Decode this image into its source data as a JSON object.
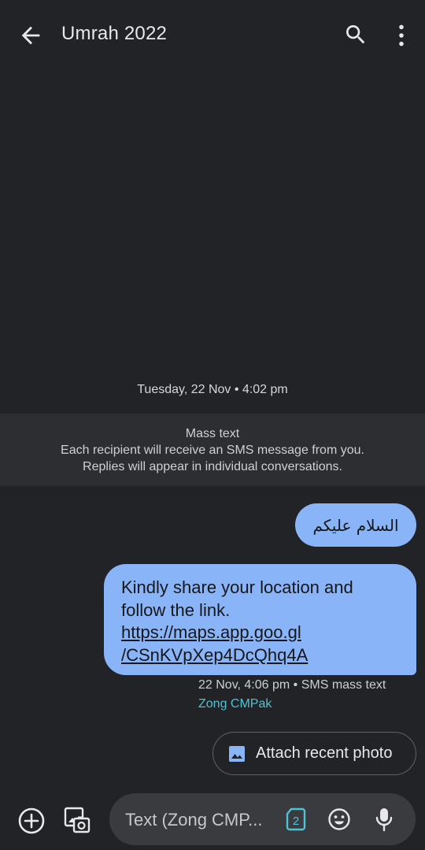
{
  "header": {
    "title": "Umrah 2022"
  },
  "conversation": {
    "date_separator": "Tuesday, 22 Nov • 4:02 pm",
    "mass_text_banner": {
      "heading": "Mass text",
      "line1": "Each recipient will receive an SMS message from you.",
      "line2": "Replies will appear in individual conversations."
    },
    "messages": [
      {
        "text": "السلام علیکم"
      },
      {
        "line1": "Kindly share your location and",
        "line2": "follow the link.",
        "link_line1": "https://maps.app.goo.gl",
        "link_line2": "/CSnKVpXep4DcQhq4A"
      }
    ],
    "message_meta": "22 Nov, 4:06 pm • SMS mass text",
    "sim_name": "Zong CMPak"
  },
  "suggestion": {
    "attach_label": "Attach recent photo"
  },
  "compose": {
    "placeholder": "Text (Zong CMP...",
    "sim_number": "2"
  },
  "colors": {
    "background": "#222326",
    "bubble": "#8ab4f8",
    "sim_accent": "#4fc3d6"
  }
}
